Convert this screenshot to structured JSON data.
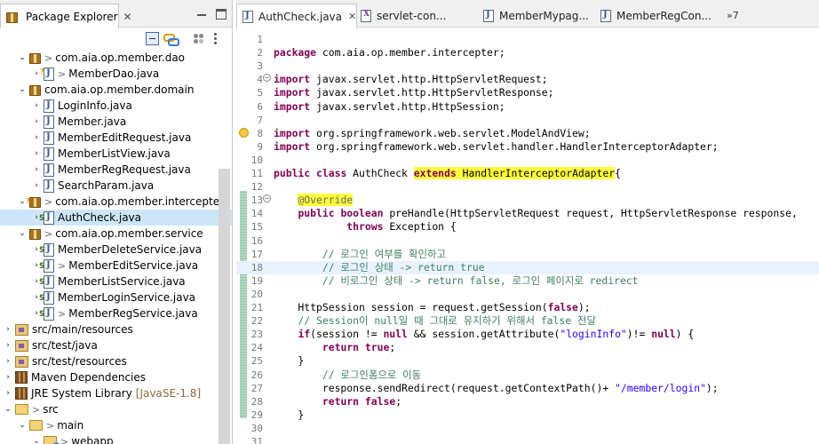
{
  "package_explorer": {
    "title": "Package Explorer",
    "tree": [
      {
        "indent": 2,
        "twisty": "expanded",
        "icon": "package-icon",
        "prefix": ">",
        "label": "com.aia.op.member.dao",
        "selected": false
      },
      {
        "indent": 3,
        "twisty": "collapsed",
        "icon": "java-file-icon",
        "prefix": ">",
        "label": "MemberDao.java",
        "selected": false,
        "deco": true
      },
      {
        "indent": 2,
        "twisty": "expanded",
        "icon": "package-icon",
        "prefix": "",
        "label": "com.aia.op.member.domain",
        "selected": false
      },
      {
        "indent": 3,
        "twisty": "collapsed",
        "icon": "java-file-icon",
        "prefix": "",
        "label": "LoginInfo.java",
        "selected": false
      },
      {
        "indent": 3,
        "twisty": "collapsed",
        "icon": "java-file-icon",
        "prefix": "",
        "label": "Member.java",
        "selected": false
      },
      {
        "indent": 3,
        "twisty": "collapsed",
        "icon": "java-file-icon",
        "prefix": "",
        "label": "MemberEditRequest.java",
        "selected": false
      },
      {
        "indent": 3,
        "twisty": "collapsed",
        "icon": "java-file-icon",
        "prefix": "",
        "label": "MemberListView.java",
        "selected": false
      },
      {
        "indent": 3,
        "twisty": "collapsed",
        "icon": "java-file-icon",
        "prefix": "",
        "label": "MemberRegRequest.java",
        "selected": false
      },
      {
        "indent": 3,
        "twisty": "collapsed",
        "icon": "java-file-icon",
        "prefix": "",
        "label": "SearchParam.java",
        "selected": false
      },
      {
        "indent": 2,
        "twisty": "expanded",
        "icon": "package-icon",
        "prefix": ">",
        "label": "com.aia.op.member.intercepte",
        "selected": false,
        "deco": true
      },
      {
        "indent": 3,
        "twisty": "collapsed",
        "icon": "spring-java-file-icon",
        "prefix": "",
        "label": "AuthCheck.java",
        "selected": true
      },
      {
        "indent": 2,
        "twisty": "expanded",
        "icon": "package-icon",
        "prefix": ">",
        "label": "com.aia.op.member.service",
        "selected": false
      },
      {
        "indent": 3,
        "twisty": "collapsed",
        "icon": "spring-java-file-icon",
        "prefix": "",
        "label": "MemberDeleteService.java",
        "selected": false
      },
      {
        "indent": 3,
        "twisty": "collapsed",
        "icon": "spring-java-file-icon",
        "prefix": ">",
        "label": "MemberEditService.java",
        "selected": false
      },
      {
        "indent": 3,
        "twisty": "collapsed",
        "icon": "spring-java-file-icon",
        "prefix": "",
        "label": "MemberListService.java",
        "selected": false
      },
      {
        "indent": 3,
        "twisty": "collapsed",
        "icon": "spring-java-file-icon",
        "prefix": "",
        "label": "MemberLoginService.java",
        "selected": false
      },
      {
        "indent": 3,
        "twisty": "collapsed",
        "icon": "spring-java-file-icon",
        "prefix": ">",
        "label": "MemberRegService.java",
        "selected": false
      },
      {
        "indent": 1,
        "twisty": "collapsed",
        "icon": "source-folder-icon",
        "prefix": "",
        "label": "src/main/resources",
        "selected": false
      },
      {
        "indent": 1,
        "twisty": "collapsed",
        "icon": "source-folder-icon",
        "prefix": "",
        "label": "src/test/java",
        "selected": false
      },
      {
        "indent": 1,
        "twisty": "collapsed",
        "icon": "source-folder-icon",
        "prefix": "",
        "label": "src/test/resources",
        "selected": false
      },
      {
        "indent": 1,
        "twisty": "collapsed",
        "icon": "library-icon",
        "prefix": "",
        "label": "Maven Dependencies",
        "selected": false
      },
      {
        "indent": 1,
        "twisty": "collapsed",
        "icon": "library-icon",
        "prefix": "",
        "label": "JRE System Library",
        "suffix": "[JavaSE-1.8]",
        "selected": false
      },
      {
        "indent": 1,
        "twisty": "expanded",
        "icon": "folder-icon",
        "prefix": ">",
        "label": "src",
        "selected": false
      },
      {
        "indent": 2,
        "twisty": "expanded",
        "icon": "folder-icon",
        "prefix": ">",
        "label": "main",
        "selected": false
      },
      {
        "indent": 3,
        "twisty": "expanded",
        "icon": "web-folder-icon",
        "prefix": ">",
        "label": "webapp",
        "selected": false
      }
    ]
  },
  "editor": {
    "tabs": [
      {
        "label": "AuthCheck.java",
        "icon": "java-file-icon",
        "active": true
      },
      {
        "label": "servlet-con...",
        "icon": "xml-file-icon",
        "active": false
      },
      {
        "label": "MemberMypag...",
        "icon": "java-file-icon",
        "active": false
      },
      {
        "label": "MemberRegCon...",
        "icon": "java-file-icon",
        "active": false
      }
    ],
    "more_tabs": "»7",
    "current_line": 18,
    "lines": [
      {
        "n": "1",
        "t": []
      },
      {
        "n": "2",
        "t": [
          [
            "kw",
            "package"
          ],
          [
            "",
            "com.aia.op.member.intercepter;"
          ]
        ]
      },
      {
        "n": "3",
        "t": []
      },
      {
        "n": "4",
        "fold": true,
        "t": [
          [
            "kw",
            "import"
          ],
          [
            "",
            "javax.servlet.http.HttpServletRequest;"
          ]
        ]
      },
      {
        "n": "5",
        "t": [
          [
            "kw",
            "import"
          ],
          [
            "",
            "javax.servlet.http.HttpServletResponse;"
          ]
        ]
      },
      {
        "n": "6",
        "t": [
          [
            "kw",
            "import"
          ],
          [
            "",
            "javax.servlet.http.HttpSession;"
          ]
        ]
      },
      {
        "n": "7",
        "t": []
      },
      {
        "n": "8",
        "warn": true,
        "t": [
          [
            "kw",
            "import"
          ],
          [
            "",
            "org.springframework.web.servlet.ModelAndView;"
          ]
        ]
      },
      {
        "n": "9",
        "t": [
          [
            "kw",
            "import"
          ],
          [
            "",
            "org.springframework.web.servlet.handler.HandlerInterceptorAdapter;"
          ]
        ]
      },
      {
        "n": "10",
        "t": []
      },
      {
        "n": "11",
        "t": [
          [
            "kw",
            "public"
          ],
          [
            "kw",
            "class"
          ],
          [
            "",
            "AuthCheck"
          ],
          [
            "kw hl",
            "extends"
          ],
          [
            "hl",
            "HandlerInterceptorAdapter"
          ],
          [
            "",
            "{"
          ]
        ]
      },
      {
        "n": "12",
        "t": []
      },
      {
        "n": "13",
        "fold": true,
        "t": [
          [
            "",
            "    "
          ],
          [
            "ann hl",
            "@Override"
          ]
        ]
      },
      {
        "n": "14",
        "t": [
          [
            "",
            "    "
          ],
          [
            "kw",
            "public"
          ],
          [
            "kw",
            "boolean"
          ],
          [
            "",
            "preHandle(HttpServletRequest request, HttpServletResponse response,"
          ]
        ]
      },
      {
        "n": "15",
        "t": [
          [
            "",
            "            "
          ],
          [
            "kw",
            "throws"
          ],
          [
            "",
            "Exception {"
          ]
        ]
      },
      {
        "n": "16",
        "t": []
      },
      {
        "n": "17",
        "t": [
          [
            "cm",
            "        // 로그인 여부를 확인하고"
          ]
        ]
      },
      {
        "n": "18",
        "t": [
          [
            "cm",
            "        // 로그인 상태 -> return true"
          ]
        ]
      },
      {
        "n": "19",
        "t": [
          [
            "cm",
            "        // 비로그인 상태 -> return false, 로그인 페이지로 redirect"
          ]
        ]
      },
      {
        "n": "20",
        "t": []
      },
      {
        "n": "21",
        "t": [
          [
            "",
            "    HttpSession session = request.getSession("
          ],
          [
            "kw",
            "false"
          ],
          [
            "",
            ");"
          ]
        ]
      },
      {
        "n": "22",
        "t": [
          [
            "cm",
            "    // Session이 null일 때 그대로 유지하기 위해서 false 전달"
          ]
        ]
      },
      {
        "n": "23",
        "t": [
          [
            "",
            "    "
          ],
          [
            "kw",
            "if"
          ],
          [
            "",
            "(session != "
          ],
          [
            "kw",
            "null"
          ],
          [
            "",
            "&& session.getAttribute("
          ],
          [
            "st",
            "\"loginInfo\""
          ],
          [
            "",
            ")!="
          ],
          [
            "kw",
            "null"
          ],
          [
            "",
            ") {"
          ]
        ]
      },
      {
        "n": "24",
        "t": [
          [
            "",
            "        "
          ],
          [
            "kw",
            "return"
          ],
          [
            "kw",
            "true"
          ],
          [
            "",
            ";"
          ]
        ]
      },
      {
        "n": "25",
        "t": [
          [
            "",
            "    }"
          ]
        ]
      },
      {
        "n": "26",
        "t": [
          [
            "cm",
            "        // 로그인폼으로 이동"
          ]
        ]
      },
      {
        "n": "27",
        "t": [
          [
            "",
            "        response.sendRedirect(request.getContextPath()+"
          ],
          [
            "st",
            "\"/member/login\""
          ],
          [
            "",
            ");"
          ]
        ]
      },
      {
        "n": "28",
        "t": [
          [
            "",
            "        "
          ],
          [
            "kw",
            "return"
          ],
          [
            "kw",
            "false"
          ],
          [
            "",
            ";"
          ]
        ]
      },
      {
        "n": "29",
        "t": [
          [
            "",
            "    }"
          ]
        ]
      },
      {
        "n": "30",
        "t": []
      },
      {
        "n": "31",
        "t": []
      }
    ]
  },
  "colors": {
    "keyword": "#7f0055",
    "comment": "#3f7f5f",
    "string": "#2a00ff",
    "annotation": "#646464",
    "highlight": "#ffff3c",
    "selection": "#cde6f7"
  }
}
